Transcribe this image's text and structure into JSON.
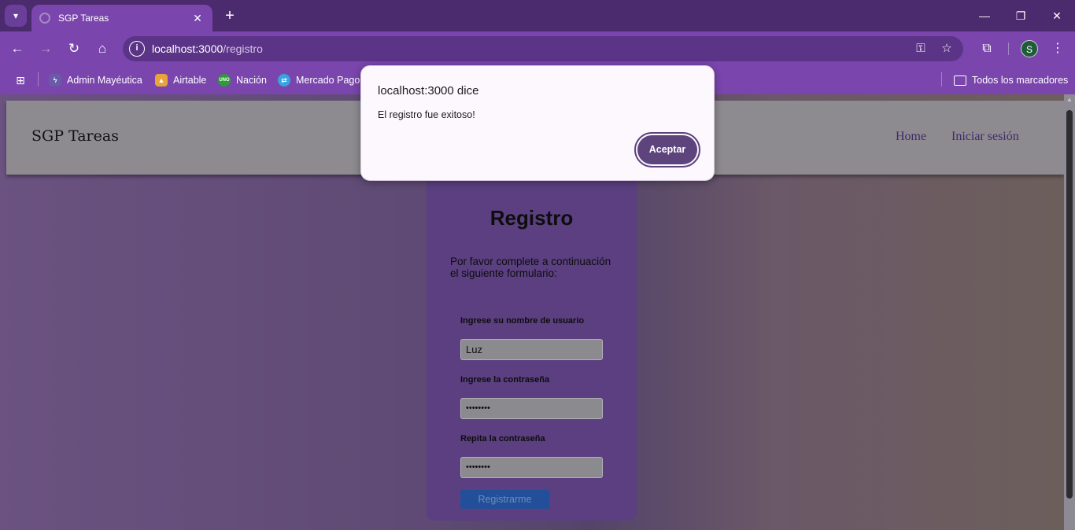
{
  "browser": {
    "tab_title": "SGP Tareas",
    "new_tab_symbol": "+",
    "url_host": "localhost:3000",
    "url_path": "/registro",
    "profile_initial": "S",
    "bookmarks": [
      {
        "label": "Admin Mayéutica",
        "icon": "mayeutica-icon",
        "icon_text": "",
        "color": "#6a5aa8"
      },
      {
        "label": "Airtable",
        "icon": "airtable-icon",
        "icon_text": "",
        "color": "#e8a33a"
      },
      {
        "label": "Nación",
        "icon": "nacion-icon",
        "icon_text": "UNO",
        "color": "#2f9a3a"
      },
      {
        "label": "Mercado Pago",
        "icon": "mercadopago-icon",
        "icon_text": "",
        "color": "#3aa3e0"
      }
    ],
    "all_bookmarks_label": "Todos los marcadores"
  },
  "page": {
    "brand": "SGP Tareas",
    "nav": [
      {
        "label": "Home"
      },
      {
        "label": "Iniciar sesión"
      }
    ],
    "form": {
      "title": "Registro",
      "description": "Por favor complete a continuación el siguiente formulario:",
      "username_label": "Ingrese su nombre de usuario",
      "username_value": "Luz",
      "password_label": "Ingrese la contraseña",
      "password_value": "••••••••",
      "repeat_label": "Repita la contraseña",
      "repeat_value": "••••••••",
      "submit_label": "Registrarme"
    }
  },
  "dialog": {
    "title": "localhost:3000 dice",
    "message": "El registro fue exitoso!",
    "button_label": "Aceptar"
  },
  "colors": {
    "accent": "#7a45ad",
    "dialog_button": "#5d447d",
    "submit_button": "#234f9a"
  }
}
